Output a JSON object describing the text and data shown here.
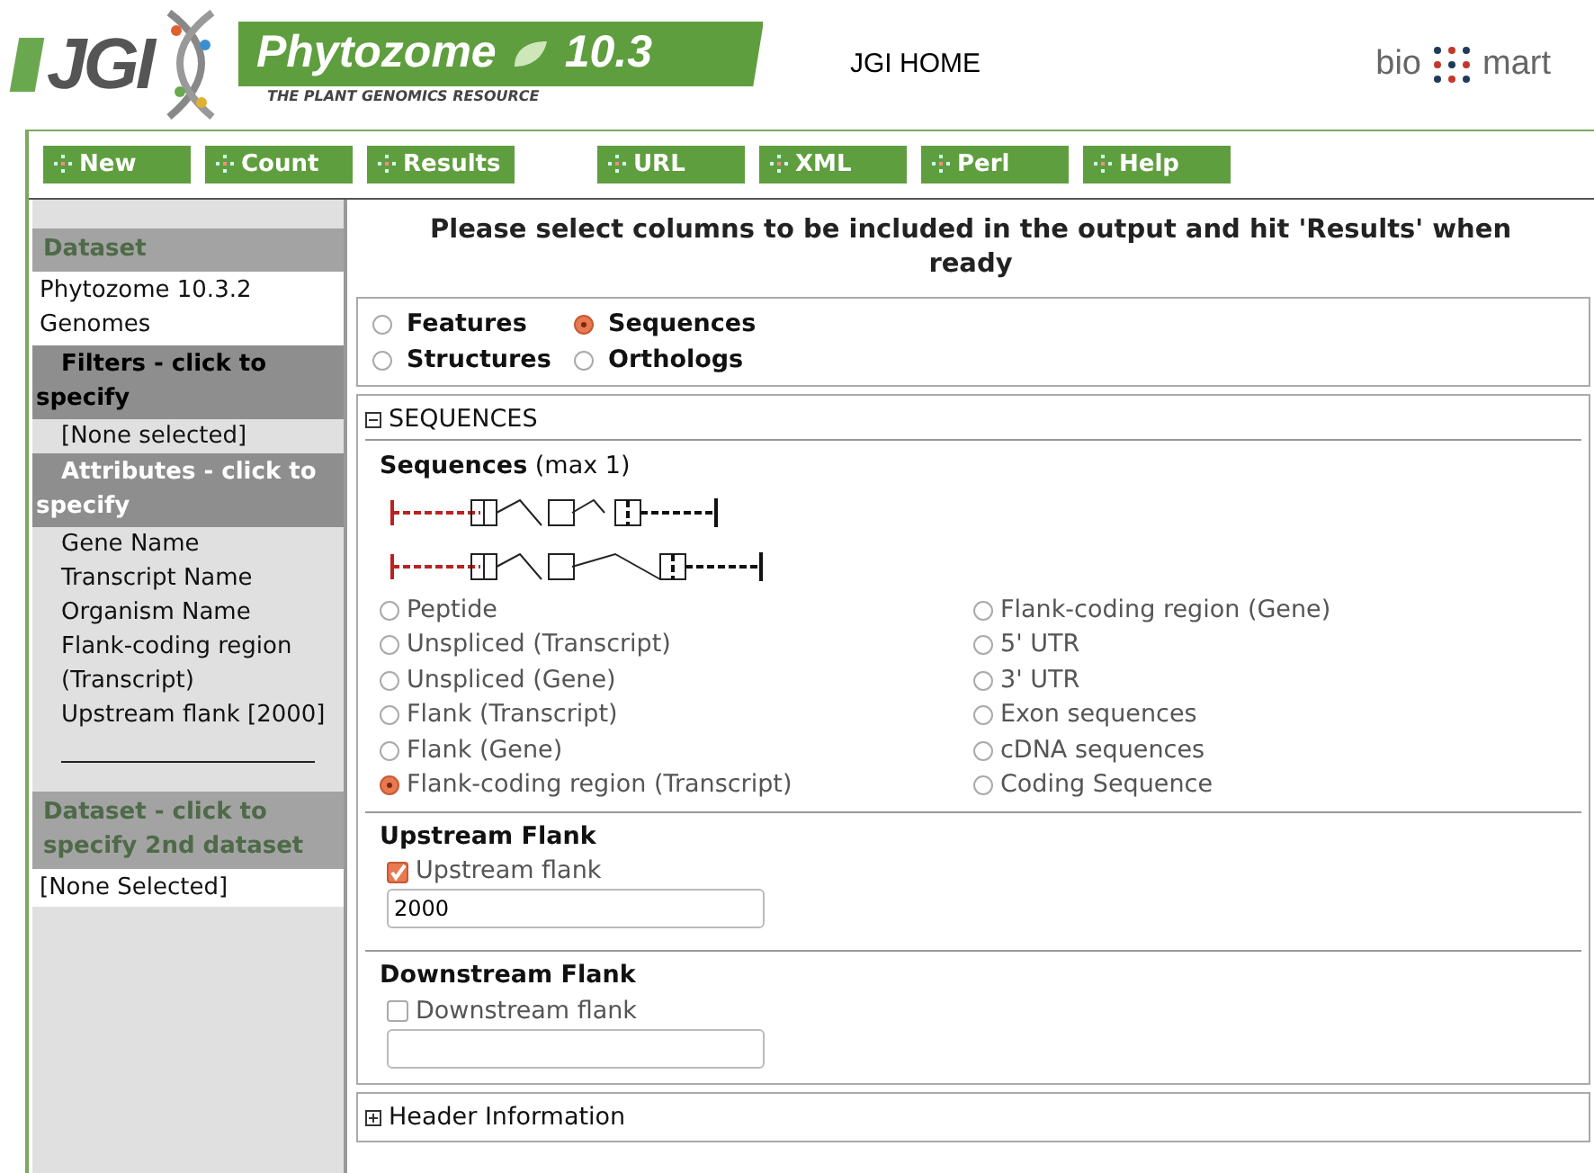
{
  "header": {
    "logo_text": "JGI",
    "banner_title": "Phytozome",
    "banner_version": "10.3",
    "banner_subtitle": "THE PLANT GENOMICS RESOURCE",
    "home_link": "JGI HOME",
    "biomart_left": "bio",
    "biomart_right": "mart"
  },
  "toolbar_groups": [
    [
      "New",
      "Count",
      "Results"
    ],
    [
      "URL",
      "XML",
      "Perl",
      "Help"
    ]
  ],
  "sidebar": [
    {
      "kind": "heading",
      "text": "Dataset"
    },
    {
      "kind": "value",
      "text": "Phytozome 10.3.2 Genomes"
    },
    {
      "kind": "subheading",
      "text": "Filters - click to specify",
      "highlighted": true
    },
    {
      "kind": "item",
      "text": "[None selected]"
    },
    {
      "kind": "subheading",
      "text": "Attributes - click to specify",
      "highlighted": false
    },
    {
      "kind": "item",
      "text": "Gene Name"
    },
    {
      "kind": "item",
      "text": "Transcript Name"
    },
    {
      "kind": "item",
      "text": "Organism Name"
    },
    {
      "kind": "item",
      "text": "Flank-coding region (Transcript)"
    },
    {
      "kind": "item",
      "text": "Upstream flank [2000]"
    },
    {
      "kind": "divider"
    },
    {
      "kind": "heading",
      "text": "Dataset - click to specify 2nd dataset"
    },
    {
      "kind": "value",
      "text": "[None Selected]"
    }
  ],
  "instruction": "Please select columns to be included in the output and hit 'Results' when ready",
  "attribute_pages": [
    {
      "label": "Features",
      "selected": false
    },
    {
      "label": "Sequences",
      "selected": true
    },
    {
      "label": "Structures",
      "selected": false
    },
    {
      "label": "Orthologs",
      "selected": false
    }
  ],
  "sequences_section": {
    "title": "SEQUENCES",
    "expanded": true,
    "group_title": "Sequences",
    "group_note": "(max 1)",
    "options_left": [
      {
        "label": "Peptide",
        "selected": false
      },
      {
        "label": "Unspliced (Transcript)",
        "selected": false
      },
      {
        "label": "Unspliced (Gene)",
        "selected": false
      },
      {
        "label": "Flank (Transcript)",
        "selected": false
      },
      {
        "label": "Flank (Gene)",
        "selected": false
      },
      {
        "label": "Flank-coding region (Transcript)",
        "selected": true
      }
    ],
    "options_right": [
      {
        "label": "Flank-coding region (Gene)",
        "selected": false
      },
      {
        "label": "5' UTR",
        "selected": false
      },
      {
        "label": "3' UTR",
        "selected": false
      },
      {
        "label": "Exon sequences",
        "selected": false
      },
      {
        "label": "cDNA sequences",
        "selected": false
      },
      {
        "label": "Coding Sequence",
        "selected": false
      }
    ],
    "flanks": [
      {
        "title": "Upstream Flank",
        "label": "Upstream flank",
        "checked": true,
        "value": "2000"
      },
      {
        "title": "Downstream Flank",
        "label": "Downstream flank",
        "checked": false
      }
    ]
  },
  "header_section": {
    "title": "Header Information",
    "expanded": false
  }
}
